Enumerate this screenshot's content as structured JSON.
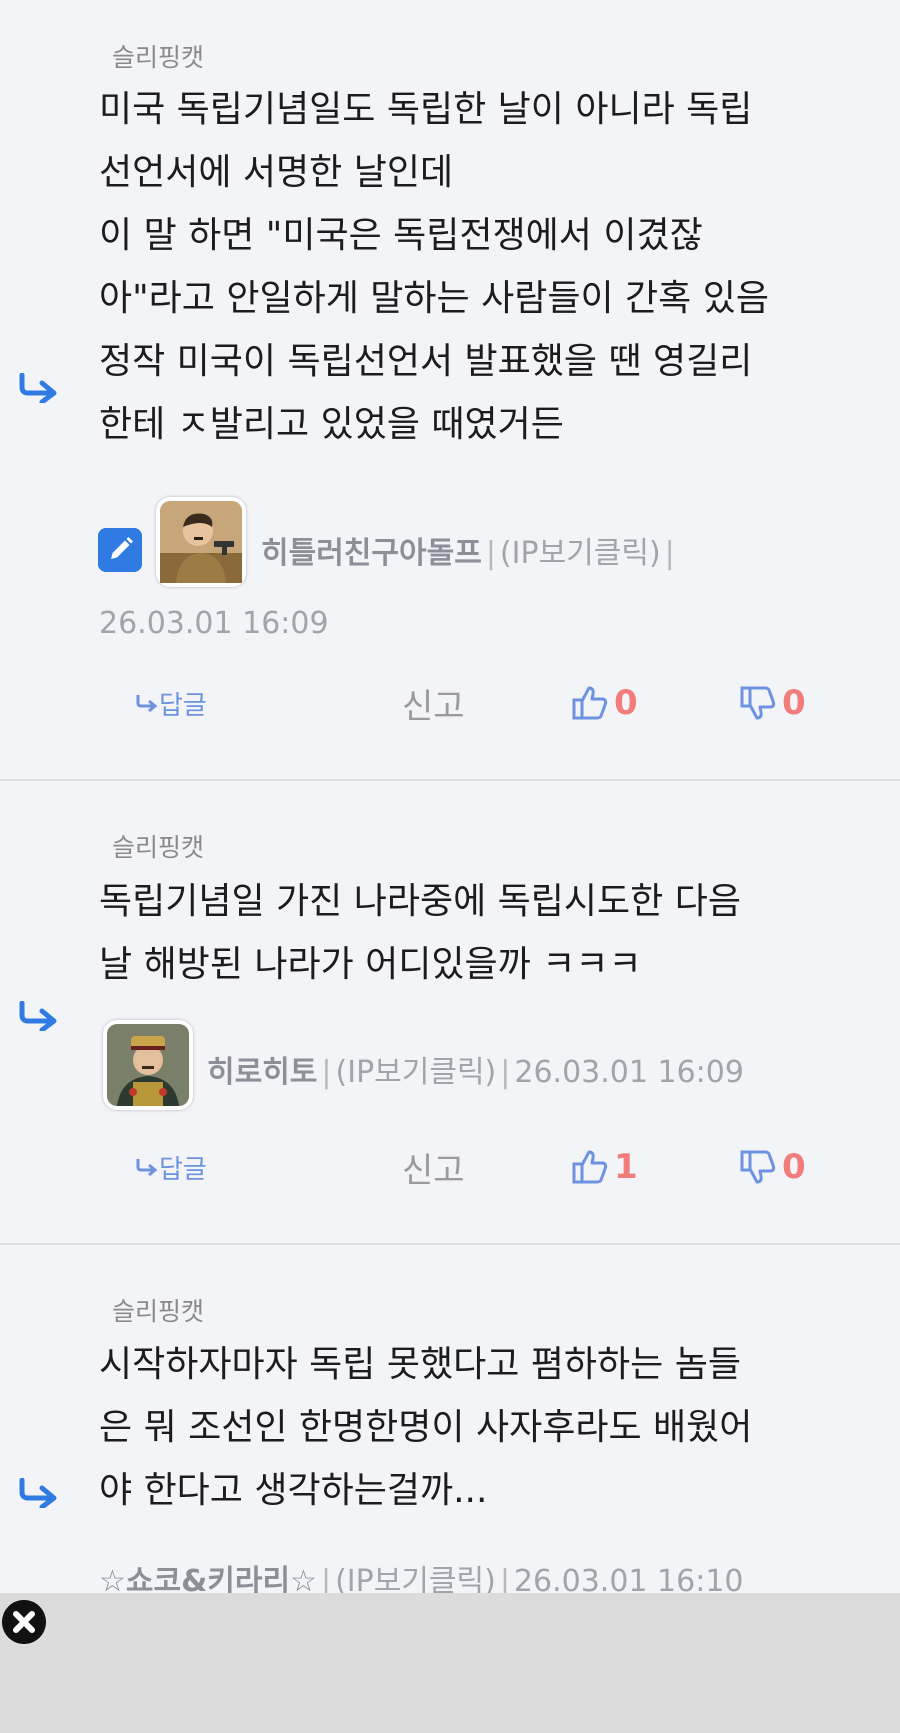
{
  "comments": [
    {
      "reply_to": "슬리핑캣",
      "lines": [
        "미국 독립기념일도 독립한 날이 아니라 독립",
        "선언서에 서명한 날인데",
        "이 말 하면 \"미국은 독립전쟁에서 이겼잖",
        "아\"라고 안일하게 말하는 사람들이 간혹 있음",
        "정작 미국이 독립선언서 발표했을 땐 영길리",
        "한테 ㅈ발리고 있었을 때였거든"
      ],
      "author": "히틀러친구아돌프",
      "ip_label": "(IP보기클릭)",
      "timestamp": "26.03.01 16:09",
      "reply_label": "답글",
      "report_label": "신고",
      "likes": "0",
      "dislikes": "0"
    },
    {
      "reply_to": "슬리핑캣",
      "lines": [
        "독립기념일 가진 나라중에 독립시도한 다음",
        "날 해방된 나라가 어디있을까 ㅋㅋㅋ"
      ],
      "author": "히로히토",
      "ip_label": "(IP보기클릭)",
      "timestamp": "26.03.01 16:09",
      "reply_label": "답글",
      "report_label": "신고",
      "likes": "1",
      "dislikes": "0"
    },
    {
      "reply_to": "슬리핑캣",
      "lines": [
        "시작하자마자 독립 못했다고 폄하하는 놈들",
        "은 뭐 조선인 한명한명이 사자후라도 배웠어",
        "야 한다고 생각하는걸까..."
      ],
      "author": "☆쇼코&키라리☆",
      "ip_label": "(IP보기클릭)",
      "timestamp": "26.03.01 16:10"
    }
  ],
  "meta_separator": "|",
  "icons": {
    "reply_arrow": "reply-arrow-icon",
    "edit": "pencil-icon",
    "like": "thumbs-up-icon",
    "dislike": "thumbs-down-icon",
    "close": "close-icon"
  },
  "colors": {
    "accent_blue": "#2f7be3",
    "count_red": "#f27b7b",
    "reply_link": "#6d93e0"
  }
}
